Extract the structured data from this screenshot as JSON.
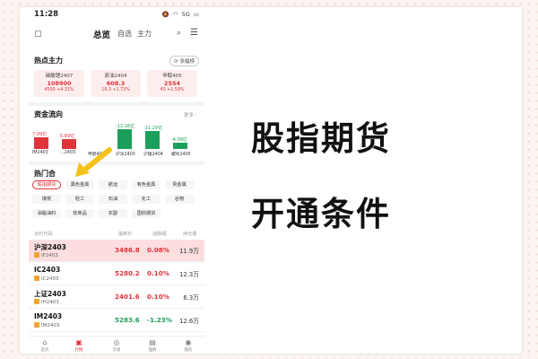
{
  "status_bar": {
    "time": "11:28",
    "network": "5G"
  },
  "nav": {
    "tabs": [
      "总览",
      "自选",
      "主力"
    ]
  },
  "hot_main": {
    "title": "热点主力",
    "rank_link": "涨幅榜",
    "cards": [
      {
        "name": "碳酸锂2407",
        "price": "108900",
        "change": "4500 +4.31%"
      },
      {
        "name": "原油2404",
        "price": "608.3",
        "change": "10.3 +1.72%"
      },
      {
        "name": "甲醇405",
        "price": "2554",
        "change": "40 +1.59%"
      }
    ]
  },
  "fund_flow": {
    "title": "资金流向",
    "more": "更多 ›",
    "bars": [
      {
        "label": "IM2403",
        "value": "7.09亿",
        "amount": 7.09,
        "direction": "in"
      },
      {
        "label": "…2403",
        "value": "5.89亿",
        "amount": 5.89,
        "direction": "in"
      },
      {
        "label": "甲醇405",
        "value": "",
        "amount": 0,
        "direction": "in"
      },
      {
        "label": "沪深2403",
        "value": "-12.16亿",
        "amount": -12.16,
        "direction": "out"
      },
      {
        "label": "沪镍2404",
        "value": "-11.29亿",
        "amount": -11.29,
        "direction": "out"
      },
      {
        "label": "螺纹2405",
        "value": "-4.09亿",
        "amount": -4.09,
        "direction": "out"
      }
    ]
  },
  "hot_sectors": {
    "title": "热门合",
    "chips": [
      "股指期货",
      "黑色金属",
      "航运",
      "有色金属",
      "贵金属",
      "煤炭",
      "轻工",
      "石油",
      "化工",
      "谷物",
      "油脂油料",
      "软商品",
      "农副",
      "国债期货"
    ]
  },
  "table": {
    "headers": [
      "合约代码",
      "最新价",
      "涨跌幅",
      "持仓量"
    ],
    "rows": [
      {
        "name": "沪深2403",
        "code": "IF2403",
        "price": "3486.8",
        "change": "0.08%",
        "oi": "11.9万",
        "dir": "up"
      },
      {
        "name": "IC2403",
        "code": "IC2403",
        "price": "5280.2",
        "change": "0.10%",
        "oi": "12.3万",
        "dir": "up"
      },
      {
        "name": "上证2403",
        "code": "IH2403",
        "price": "2401.6",
        "change": "0.10%",
        "oi": "6.3万",
        "dir": "up"
      },
      {
        "name": "IM2403",
        "code": "IM2403",
        "price": "5283.6",
        "change": "-1.23%",
        "oi": "12.6万",
        "dir": "down"
      }
    ]
  },
  "bottom_nav": {
    "items": [
      "首页",
      "行情",
      "交易",
      "理财",
      "我的"
    ]
  },
  "headline": {
    "line1": "股指期货",
    "line2": "开通条件"
  },
  "colors": {
    "up": "#e0333a",
    "down": "#1aa05a",
    "highlight_row": "#fcdede",
    "arrow": "#f4c21b"
  }
}
